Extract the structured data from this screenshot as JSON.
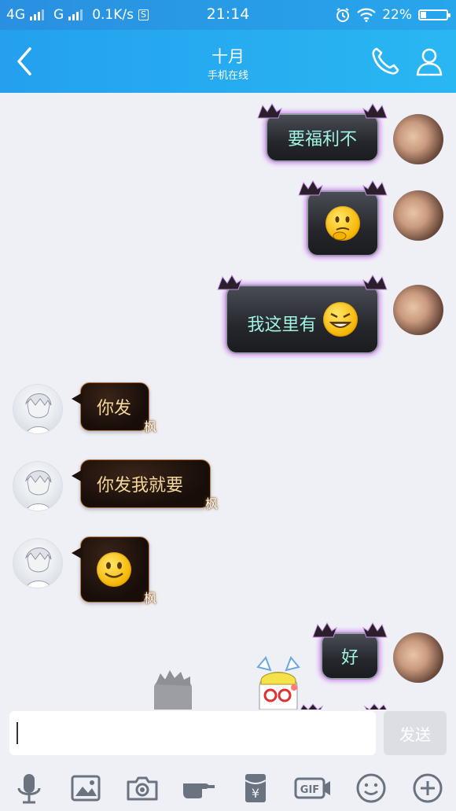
{
  "status_bar": {
    "network_1": "4G",
    "network_2": "G",
    "speed": "0.1K/s",
    "sim_badge": "S",
    "time": "21:14",
    "battery": "22%",
    "battery_level": 0.22
  },
  "header": {
    "title": "十月",
    "subtitle": "手机在线"
  },
  "messages": [
    {
      "side": "me",
      "text": "要福利不"
    },
    {
      "side": "me",
      "text": "",
      "emoji": "thinking-smiley-icon"
    },
    {
      "side": "me",
      "text": "我这里有",
      "emoji": "grin-smiley-icon"
    },
    {
      "side": "other",
      "text": "你发"
    },
    {
      "side": "other",
      "text": "你发我就要"
    },
    {
      "side": "other",
      "text": "",
      "emoji": "smile-smiley-icon"
    },
    {
      "side": "me",
      "text": "好"
    }
  ],
  "bubble_signature": "枫",
  "input": {
    "value": "",
    "send_label": "发送"
  },
  "toolbar": {
    "icons": [
      "microphone-icon",
      "image-icon",
      "camera-icon",
      "poke-hand-icon",
      "red-packet-icon",
      "gif-icon",
      "emoji-icon",
      "plus-icon"
    ],
    "gif_label": "GIF"
  },
  "colors": {
    "header": "#29b7f2",
    "chat_bg": "#eef0f6",
    "my_text": "#9ff3e1",
    "other_text": "#f3d79c"
  }
}
